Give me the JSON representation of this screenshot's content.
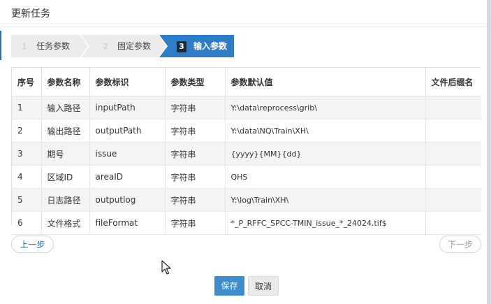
{
  "dialog": {
    "title": "更新任务"
  },
  "steps": [
    {
      "num": "1",
      "label": "任务参数",
      "active": false
    },
    {
      "num": "2",
      "label": "固定参数",
      "active": false
    },
    {
      "num": "3",
      "label": "输入参数",
      "active": true
    }
  ],
  "table": {
    "headers": [
      "序号",
      "参数名称",
      "参数标识",
      "参数类型",
      "参数默认值",
      "文件后缀名"
    ],
    "rows": [
      [
        "1",
        "输入路径",
        "inputPath",
        "字符串",
        "Y:\\data\\reprocess\\grib\\",
        ""
      ],
      [
        "2",
        "输出路径",
        "outputPath",
        "字符串",
        "Y:\\data\\NQ\\Train\\XH\\",
        ""
      ],
      [
        "3",
        "期号",
        "issue",
        "字符串",
        "{yyyy}{MM}{dd}",
        ""
      ],
      [
        "4",
        "区域ID",
        "areaID",
        "字符串",
        "QHS",
        ""
      ],
      [
        "5",
        "日志路径",
        "outputlog",
        "字符串",
        "Y:\\log\\Train\\XH\\",
        ""
      ],
      [
        "6",
        "文件格式",
        "fileFormat",
        "字符串",
        "*_P_RFFC_SPCC-TMIN_issue_*_24024.tif$",
        ""
      ]
    ]
  },
  "buttons": {
    "prev": "上一步",
    "next": "下一步",
    "save": "保存",
    "cancel": "取消"
  },
  "colors": {
    "accent": "#2d7ec6",
    "save": "#3f8ccc"
  }
}
